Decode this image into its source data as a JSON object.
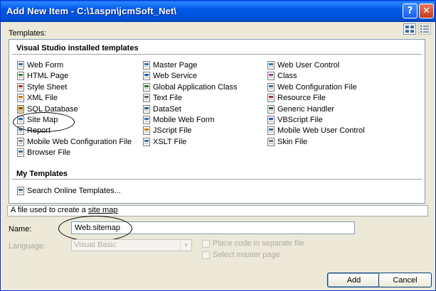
{
  "window": {
    "title": "Add New Item - C:\\1aspn\\jcmSoft_Net\\",
    "help_glyph": "?",
    "close_glyph": "✕"
  },
  "templates_label": "Templates:",
  "sections": {
    "installed": {
      "title": "Visual Studio installed templates",
      "col1": [
        {
          "label": "Web Form",
          "icon": "web-form-icon"
        },
        {
          "label": "HTML Page",
          "icon": "html-page-icon"
        },
        {
          "label": "Style Sheet",
          "icon": "style-sheet-icon"
        },
        {
          "label": "XML File",
          "icon": "xml-file-icon"
        },
        {
          "label": "SQL Database",
          "icon": "sql-database-icon"
        },
        {
          "label": "Site Map",
          "icon": "site-map-icon"
        },
        {
          "label": "Report",
          "icon": "report-icon"
        },
        {
          "label": "Mobile Web Configuration File",
          "icon": "mobile-config-icon"
        },
        {
          "label": "Browser File",
          "icon": "browser-file-icon"
        }
      ],
      "col2": [
        {
          "label": "Master Page",
          "icon": "master-page-icon"
        },
        {
          "label": "Web Service",
          "icon": "web-service-icon"
        },
        {
          "label": "Global Application Class",
          "icon": "global-app-icon"
        },
        {
          "label": "Text File",
          "icon": "text-file-icon"
        },
        {
          "label": "DataSet",
          "icon": "dataset-icon"
        },
        {
          "label": "Mobile Web Form",
          "icon": "mobile-web-form-icon"
        },
        {
          "label": "JScript File",
          "icon": "jscript-file-icon"
        },
        {
          "label": "XSLT File",
          "icon": "xslt-file-icon"
        }
      ],
      "col3": [
        {
          "label": "Web User Control",
          "icon": "web-user-control-icon"
        },
        {
          "label": "Class",
          "icon": "class-icon"
        },
        {
          "label": "Web Configuration File",
          "icon": "web-config-icon"
        },
        {
          "label": "Resource File",
          "icon": "resource-file-icon"
        },
        {
          "label": "Generic Handler",
          "icon": "generic-handler-icon"
        },
        {
          "label": "VBScript File",
          "icon": "vbscript-file-icon"
        },
        {
          "label": "Mobile Web User Control",
          "icon": "mobile-user-control-icon"
        },
        {
          "label": "Skin File",
          "icon": "skin-file-icon"
        }
      ]
    },
    "my": {
      "title": "My Templates",
      "items": [
        {
          "label": "Search Online Templates...",
          "icon": "search-online-icon"
        }
      ]
    }
  },
  "description": {
    "prefix": "A file used to create a ",
    "link": "site map"
  },
  "form": {
    "name_label": "Name:",
    "name_value": "Web.sitemap",
    "language_label": "Language:",
    "language_value": "Visual Basic",
    "place_code_label": "Place code in separate file",
    "select_master_label": "Select master page"
  },
  "buttons": {
    "add": "Add",
    "cancel": "Cancel"
  }
}
